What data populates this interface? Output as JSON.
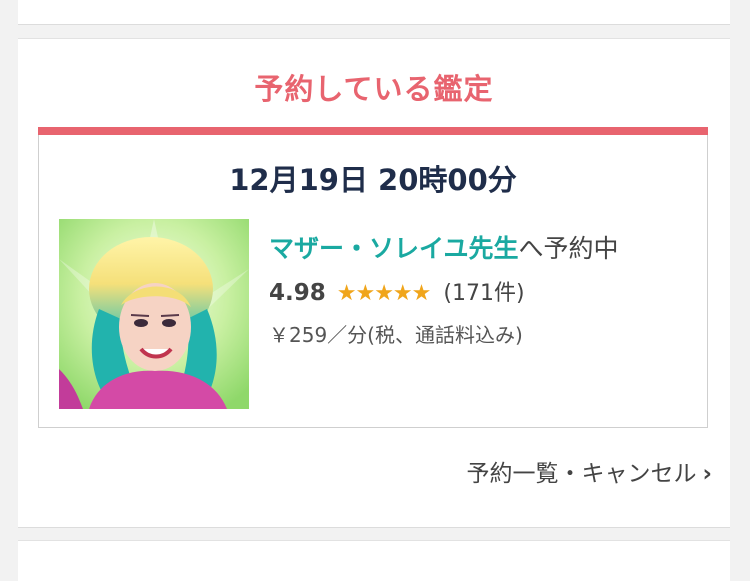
{
  "section": {
    "title": "予約している鑑定"
  },
  "booking": {
    "date": "12月19日 20時00分",
    "teacher_name": "マザー・ソレイユ先生",
    "status_suffix": "へ予約中",
    "rating": "4.98",
    "stars": "★★★★★",
    "review_count": "(171件)",
    "price": "￥259／分(税、通話料込み)",
    "avatar_icon": "teacher-portrait"
  },
  "links": {
    "list_cancel": "予約一覧・キャンセル",
    "chevron": "›"
  },
  "colors": {
    "accent": "#e8646f",
    "teacher_name": "#1aa9a1",
    "date": "#1f2d4a",
    "stars": "#f0a51b"
  }
}
